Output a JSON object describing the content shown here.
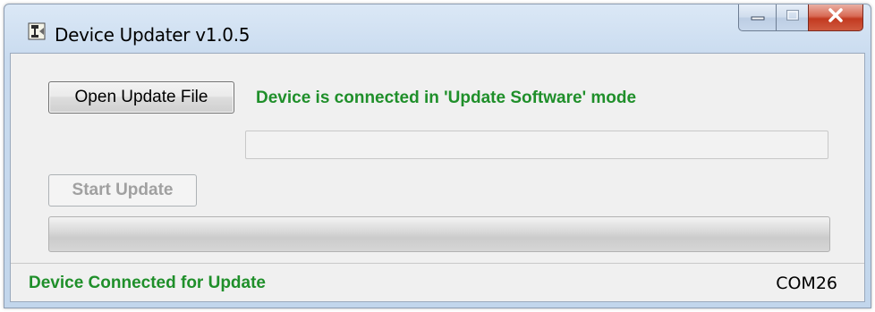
{
  "window": {
    "title": "Device Updater v1.0.5",
    "app_icon": "device-updater-icon",
    "controls": {
      "minimize_icon": "minimize-icon",
      "maximize_icon": "maximize-icon",
      "close_icon": "close-icon"
    }
  },
  "main": {
    "open_button_label": "Open Update File",
    "connection_message": "Device is connected in 'Update Software' mode",
    "file_path_value": "",
    "start_button_label": "Start Update",
    "start_button_enabled": false,
    "progress_fraction": 0
  },
  "statusbar": {
    "status_text": "Device Connected for Update",
    "port": "COM26"
  },
  "colors": {
    "status_green": "#1f8f2a",
    "close_red": "#c23a20",
    "titlebar_blue": "#c9dbef"
  }
}
